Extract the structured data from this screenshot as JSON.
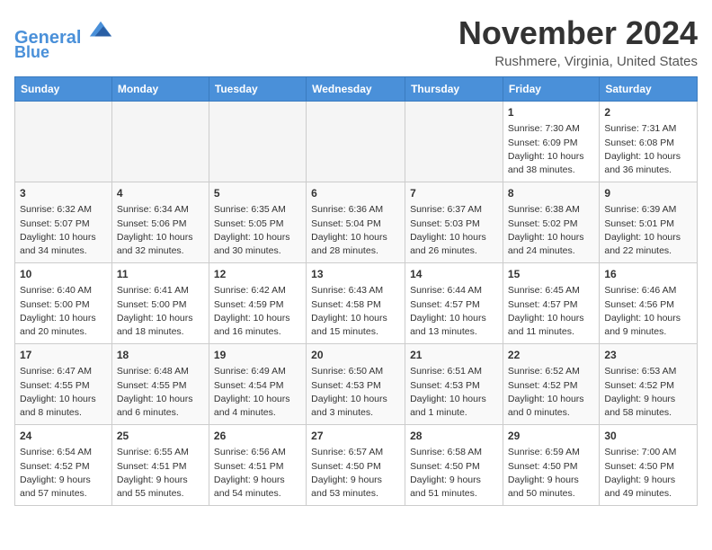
{
  "header": {
    "logo_line1": "General",
    "logo_line2": "Blue",
    "month": "November 2024",
    "location": "Rushmere, Virginia, United States"
  },
  "weekdays": [
    "Sunday",
    "Monday",
    "Tuesday",
    "Wednesday",
    "Thursday",
    "Friday",
    "Saturday"
  ],
  "weeks": [
    [
      {
        "day": "",
        "content": ""
      },
      {
        "day": "",
        "content": ""
      },
      {
        "day": "",
        "content": ""
      },
      {
        "day": "",
        "content": ""
      },
      {
        "day": "",
        "content": ""
      },
      {
        "day": "1",
        "content": "Sunrise: 7:30 AM\nSunset: 6:09 PM\nDaylight: 10 hours\nand 38 minutes."
      },
      {
        "day": "2",
        "content": "Sunrise: 7:31 AM\nSunset: 6:08 PM\nDaylight: 10 hours\nand 36 minutes."
      }
    ],
    [
      {
        "day": "3",
        "content": "Sunrise: 6:32 AM\nSunset: 5:07 PM\nDaylight: 10 hours\nand 34 minutes."
      },
      {
        "day": "4",
        "content": "Sunrise: 6:34 AM\nSunset: 5:06 PM\nDaylight: 10 hours\nand 32 minutes."
      },
      {
        "day": "5",
        "content": "Sunrise: 6:35 AM\nSunset: 5:05 PM\nDaylight: 10 hours\nand 30 minutes."
      },
      {
        "day": "6",
        "content": "Sunrise: 6:36 AM\nSunset: 5:04 PM\nDaylight: 10 hours\nand 28 minutes."
      },
      {
        "day": "7",
        "content": "Sunrise: 6:37 AM\nSunset: 5:03 PM\nDaylight: 10 hours\nand 26 minutes."
      },
      {
        "day": "8",
        "content": "Sunrise: 6:38 AM\nSunset: 5:02 PM\nDaylight: 10 hours\nand 24 minutes."
      },
      {
        "day": "9",
        "content": "Sunrise: 6:39 AM\nSunset: 5:01 PM\nDaylight: 10 hours\nand 22 minutes."
      }
    ],
    [
      {
        "day": "10",
        "content": "Sunrise: 6:40 AM\nSunset: 5:00 PM\nDaylight: 10 hours\nand 20 minutes."
      },
      {
        "day": "11",
        "content": "Sunrise: 6:41 AM\nSunset: 5:00 PM\nDaylight: 10 hours\nand 18 minutes."
      },
      {
        "day": "12",
        "content": "Sunrise: 6:42 AM\nSunset: 4:59 PM\nDaylight: 10 hours\nand 16 minutes."
      },
      {
        "day": "13",
        "content": "Sunrise: 6:43 AM\nSunset: 4:58 PM\nDaylight: 10 hours\nand 15 minutes."
      },
      {
        "day": "14",
        "content": "Sunrise: 6:44 AM\nSunset: 4:57 PM\nDaylight: 10 hours\nand 13 minutes."
      },
      {
        "day": "15",
        "content": "Sunrise: 6:45 AM\nSunset: 4:57 PM\nDaylight: 10 hours\nand 11 minutes."
      },
      {
        "day": "16",
        "content": "Sunrise: 6:46 AM\nSunset: 4:56 PM\nDaylight: 10 hours\nand 9 minutes."
      }
    ],
    [
      {
        "day": "17",
        "content": "Sunrise: 6:47 AM\nSunset: 4:55 PM\nDaylight: 10 hours\nand 8 minutes."
      },
      {
        "day": "18",
        "content": "Sunrise: 6:48 AM\nSunset: 4:55 PM\nDaylight: 10 hours\nand 6 minutes."
      },
      {
        "day": "19",
        "content": "Sunrise: 6:49 AM\nSunset: 4:54 PM\nDaylight: 10 hours\nand 4 minutes."
      },
      {
        "day": "20",
        "content": "Sunrise: 6:50 AM\nSunset: 4:53 PM\nDaylight: 10 hours\nand 3 minutes."
      },
      {
        "day": "21",
        "content": "Sunrise: 6:51 AM\nSunset: 4:53 PM\nDaylight: 10 hours\nand 1 minute."
      },
      {
        "day": "22",
        "content": "Sunrise: 6:52 AM\nSunset: 4:52 PM\nDaylight: 10 hours\nand 0 minutes."
      },
      {
        "day": "23",
        "content": "Sunrise: 6:53 AM\nSunset: 4:52 PM\nDaylight: 9 hours\nand 58 minutes."
      }
    ],
    [
      {
        "day": "24",
        "content": "Sunrise: 6:54 AM\nSunset: 4:52 PM\nDaylight: 9 hours\nand 57 minutes."
      },
      {
        "day": "25",
        "content": "Sunrise: 6:55 AM\nSunset: 4:51 PM\nDaylight: 9 hours\nand 55 minutes."
      },
      {
        "day": "26",
        "content": "Sunrise: 6:56 AM\nSunset: 4:51 PM\nDaylight: 9 hours\nand 54 minutes."
      },
      {
        "day": "27",
        "content": "Sunrise: 6:57 AM\nSunset: 4:50 PM\nDaylight: 9 hours\nand 53 minutes."
      },
      {
        "day": "28",
        "content": "Sunrise: 6:58 AM\nSunset: 4:50 PM\nDaylight: 9 hours\nand 51 minutes."
      },
      {
        "day": "29",
        "content": "Sunrise: 6:59 AM\nSunset: 4:50 PM\nDaylight: 9 hours\nand 50 minutes."
      },
      {
        "day": "30",
        "content": "Sunrise: 7:00 AM\nSunset: 4:50 PM\nDaylight: 9 hours\nand 49 minutes."
      }
    ]
  ]
}
